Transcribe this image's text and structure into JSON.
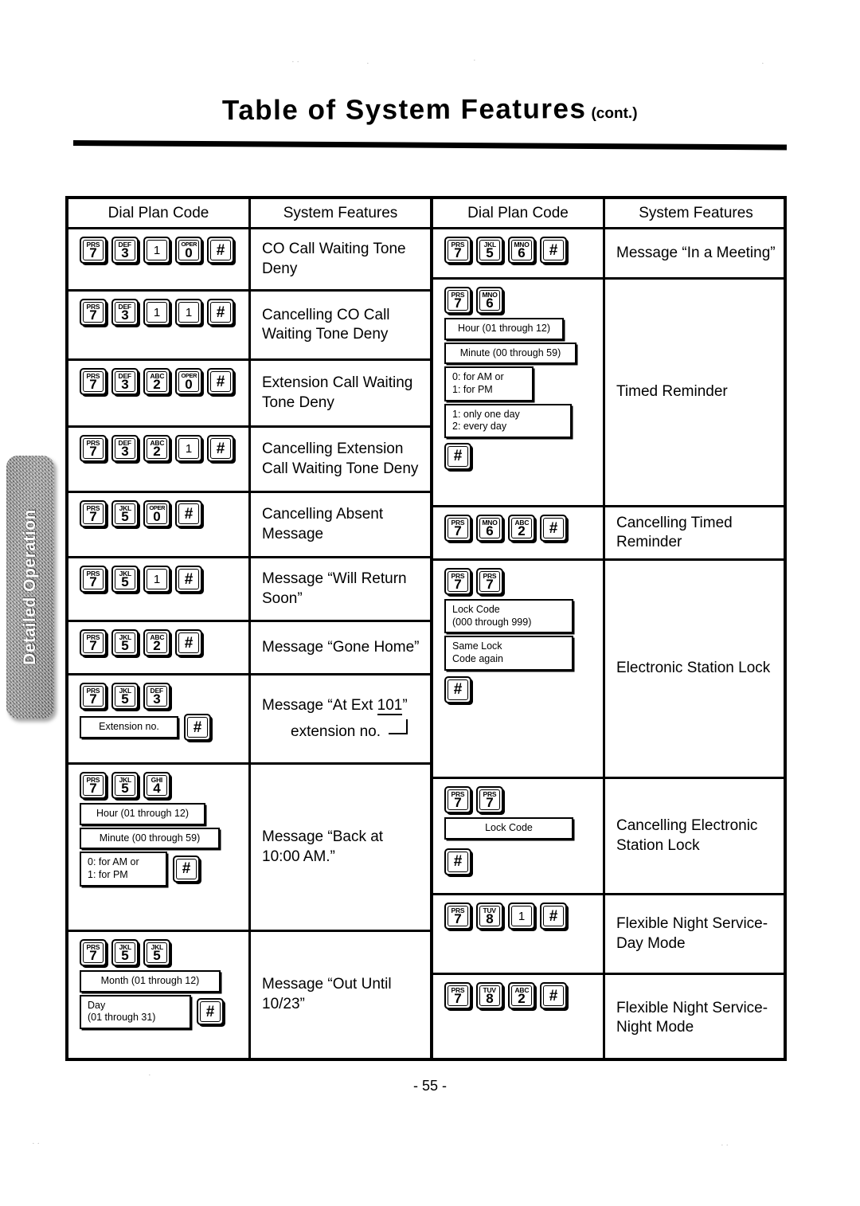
{
  "page": {
    "title_main": "Table of System Features",
    "title_cont": "(cont.)",
    "page_number": "- 55 -",
    "side_tab_label": "Detailed Operation"
  },
  "headers": {
    "dial_plan_code": "Dial Plan Code",
    "system_features": "System Features"
  },
  "keys": {
    "hash": "#",
    "alpha_2": "ABC",
    "alpha_3": "DEF",
    "alpha_4": "GHI",
    "alpha_5": "JKL",
    "alpha_6": "MNO",
    "alpha_7": "PRS",
    "alpha_8": "TUV",
    "alpha_0": "OPER"
  },
  "left_column": [
    {
      "id": "co-call-waiting-tone-deny",
      "keys": [
        {
          "alpha": "PRS",
          "digit": "7"
        },
        {
          "alpha": "DEF",
          "digit": "3"
        },
        {
          "alpha": "",
          "digit": "1"
        },
        {
          "alpha": "OPER",
          "digit": "0"
        },
        {
          "alpha": "",
          "digit": "#"
        }
      ],
      "feature": "CO Call Waiting Tone Deny"
    },
    {
      "id": "cancelling-co-call-waiting-tone-deny",
      "keys": [
        {
          "alpha": "PRS",
          "digit": "7"
        },
        {
          "alpha": "DEF",
          "digit": "3"
        },
        {
          "alpha": "",
          "digit": "1"
        },
        {
          "alpha": "",
          "digit": "1"
        },
        {
          "alpha": "",
          "digit": "#"
        }
      ],
      "feature": "Cancelling CO Call Waiting Tone Deny"
    },
    {
      "id": "extension-call-waiting-tone-deny",
      "keys": [
        {
          "alpha": "PRS",
          "digit": "7"
        },
        {
          "alpha": "DEF",
          "digit": "3"
        },
        {
          "alpha": "ABC",
          "digit": "2"
        },
        {
          "alpha": "OPER",
          "digit": "0"
        },
        {
          "alpha": "",
          "digit": "#"
        }
      ],
      "feature": "Extension Call Waiting Tone Deny"
    },
    {
      "id": "cancelling-extension-call-waiting-tone-deny",
      "keys": [
        {
          "alpha": "PRS",
          "digit": "7"
        },
        {
          "alpha": "DEF",
          "digit": "3"
        },
        {
          "alpha": "ABC",
          "digit": "2"
        },
        {
          "alpha": "",
          "digit": "1"
        },
        {
          "alpha": "",
          "digit": "#"
        }
      ],
      "feature": "Cancelling Extension Call Waiting Tone Deny"
    },
    {
      "id": "cancelling-absent-message",
      "keys": [
        {
          "alpha": "PRS",
          "digit": "7"
        },
        {
          "alpha": "JKL",
          "digit": "5"
        },
        {
          "alpha": "OPER",
          "digit": "0"
        },
        {
          "alpha": "",
          "digit": "#"
        }
      ],
      "feature": "Cancelling Absent Message"
    },
    {
      "id": "message-will-return-soon",
      "keys": [
        {
          "alpha": "PRS",
          "digit": "7"
        },
        {
          "alpha": "JKL",
          "digit": "5"
        },
        {
          "alpha": "",
          "digit": "1"
        },
        {
          "alpha": "",
          "digit": "#"
        }
      ],
      "feature": "Message “Will Return Soon”"
    },
    {
      "id": "message-gone-home",
      "keys": [
        {
          "alpha": "PRS",
          "digit": "7"
        },
        {
          "alpha": "JKL",
          "digit": "5"
        },
        {
          "alpha": "ABC",
          "digit": "2"
        },
        {
          "alpha": "",
          "digit": "#"
        }
      ],
      "feature": "Message “Gone Home”"
    },
    {
      "id": "message-at-ext-101",
      "keys": [
        {
          "alpha": "PRS",
          "digit": "7"
        },
        {
          "alpha": "JKL",
          "digit": "5"
        },
        {
          "alpha": "DEF",
          "digit": "3"
        }
      ],
      "param_box": "Extension no.",
      "feature_prefix": "Message “At Ext ",
      "feature_number": "101",
      "feature_suffix": "”",
      "feature_pointer_label": "extension no."
    },
    {
      "id": "message-back-at-1000-am",
      "keys": [
        {
          "alpha": "PRS",
          "digit": "7"
        },
        {
          "alpha": "JKL",
          "digit": "5"
        },
        {
          "alpha": "GHI",
          "digit": "4"
        }
      ],
      "param_boxes": [
        "Hour (01 through 12)",
        "Minute (00 through 59)"
      ],
      "ampm_box_line1": "0: for AM or",
      "ampm_box_line2": "1: for PM",
      "feature": "Message “Back at 10:00 AM.”"
    },
    {
      "id": "message-out-until-1023",
      "keys": [
        {
          "alpha": "PRS",
          "digit": "7"
        },
        {
          "alpha": "JKL",
          "digit": "5"
        },
        {
          "alpha": "JKL",
          "digit": "5"
        }
      ],
      "param_boxes": [
        "Month (01 through 12)"
      ],
      "day_box_line1": "Day",
      "day_box_line2": "(01 through 31)",
      "feature": "Message “Out Until 10/23”"
    }
  ],
  "right_column": [
    {
      "id": "message-in-a-meeting",
      "keys": [
        {
          "alpha": "PRS",
          "digit": "7"
        },
        {
          "alpha": "JKL",
          "digit": "5"
        },
        {
          "alpha": "MNO",
          "digit": "6"
        },
        {
          "alpha": "",
          "digit": "#"
        }
      ],
      "feature": "Message “In a Meeting”"
    },
    {
      "id": "timed-reminder",
      "keys": [
        {
          "alpha": "PRS",
          "digit": "7"
        },
        {
          "alpha": "MNO",
          "digit": "6"
        }
      ],
      "param_boxes": [
        "Hour (01 through 12)",
        "Minute (00 through 59)"
      ],
      "ampm_box_line1": "0: for AM or",
      "ampm_box_line2": "1: for PM",
      "repeat_box_line1": "1:  only one day",
      "repeat_box_line2": "2:  every day",
      "feature": "Timed Reminder"
    },
    {
      "id": "cancelling-timed-reminder",
      "keys": [
        {
          "alpha": "PRS",
          "digit": "7"
        },
        {
          "alpha": "MNO",
          "digit": "6"
        },
        {
          "alpha": "ABC",
          "digit": "2"
        },
        {
          "alpha": "",
          "digit": "#"
        }
      ],
      "feature": "Cancelling Timed Reminder"
    },
    {
      "id": "electronic-station-lock",
      "keys": [
        {
          "alpha": "PRS",
          "digit": "7"
        },
        {
          "alpha": "PRS",
          "digit": "7"
        }
      ],
      "lock_box_line1": "Lock Code",
      "lock_box_line2": "(000 through 999)",
      "same_box_line1": "Same Lock",
      "same_box_line2": "Code again",
      "feature": "Electronic Station Lock"
    },
    {
      "id": "cancelling-electronic-station-lock",
      "keys": [
        {
          "alpha": "PRS",
          "digit": "7"
        },
        {
          "alpha": "PRS",
          "digit": "7"
        }
      ],
      "lock_box": "Lock Code",
      "feature": "Cancelling Electronic Station Lock"
    },
    {
      "id": "flexible-night-service-day-mode",
      "keys": [
        {
          "alpha": "PRS",
          "digit": "7"
        },
        {
          "alpha": "TUV",
          "digit": "8"
        },
        {
          "alpha": "",
          "digit": "1"
        },
        {
          "alpha": "",
          "digit": "#"
        }
      ],
      "feature": "Flexible Night Service-Day Mode"
    },
    {
      "id": "flexible-night-service-night-mode",
      "keys": [
        {
          "alpha": "PRS",
          "digit": "7"
        },
        {
          "alpha": "TUV",
          "digit": "8"
        },
        {
          "alpha": "ABC",
          "digit": "2"
        },
        {
          "alpha": "",
          "digit": "#"
        }
      ],
      "feature": "Flexible Night Service-Night Mode"
    }
  ]
}
